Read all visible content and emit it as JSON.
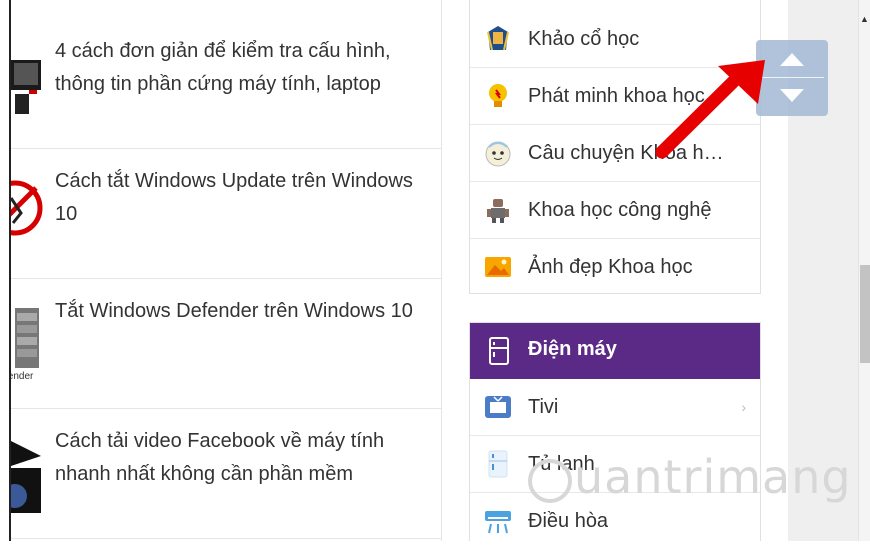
{
  "articles": [
    {
      "title": "4 cách đơn giản để kiểm tra cấu hình, thông tin phần cứng máy tính, laptop"
    },
    {
      "title": "Cách tắt Windows Update trên Windows 10"
    },
    {
      "title": "Tắt Windows Defender trên Windows 10",
      "thumb_caption": "fender"
    },
    {
      "title": "Cách tải video Facebook về máy tính nhanh nhất không cần phần mềm"
    }
  ],
  "science_categories": [
    {
      "label": "Khảo cổ học",
      "icon": "pharaoh-icon"
    },
    {
      "label": "Phát minh khoa học",
      "icon": "lightbulb-icon"
    },
    {
      "label": "Câu chuyện Khoa h…",
      "icon": "story-icon"
    },
    {
      "label": "Khoa học công nghệ",
      "icon": "robot-icon"
    },
    {
      "label": "Ảnh đẹp Khoa học",
      "icon": "picture-icon"
    }
  ],
  "electronics": {
    "header": "Điện máy",
    "items": [
      {
        "label": "Tivi",
        "icon": "tv-icon"
      },
      {
        "label": "Tủ lạnh",
        "icon": "fridge-icon"
      },
      {
        "label": "Điều hòa",
        "icon": "air-conditioner-icon"
      }
    ]
  },
  "watermark": "uantrimang",
  "colors": {
    "header_bg": "#5b2a86",
    "arrow": "#e60000"
  }
}
